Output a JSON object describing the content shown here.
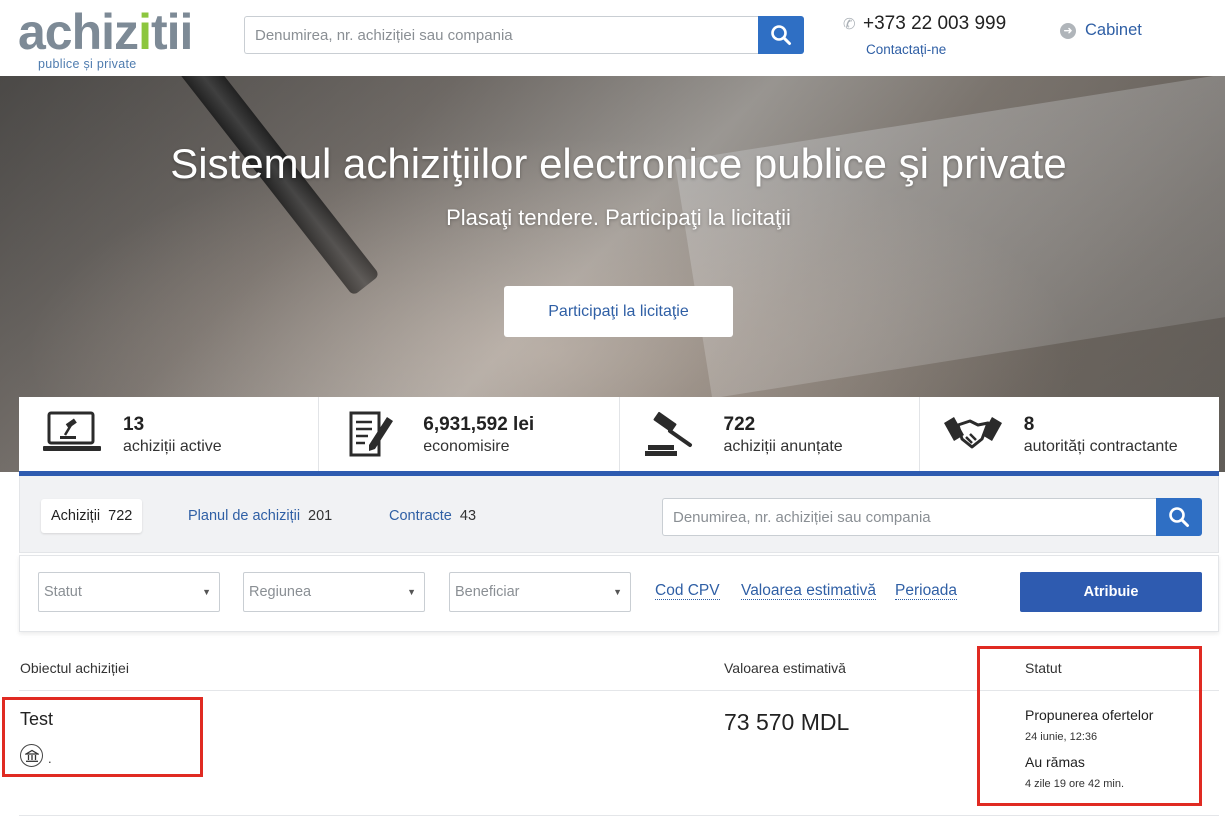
{
  "header": {
    "logo_main_a": "achiz",
    "logo_main_b": "i",
    "logo_main_c": "tii",
    "logo_sub": "publice și private",
    "search_placeholder": "Denumirea, nr. achiziției sau compania",
    "phone": "+373 22 003 999",
    "contact_label": "Contactați-ne",
    "cabinet_label": "Cabinet"
  },
  "hero": {
    "title": "Sistemul achiziţiilor electronice publice şi private",
    "subtitle": "Plasaţi tendere. Participaţi la licitaţii",
    "cta_label": "Participaţi la licitaţie"
  },
  "stats": [
    {
      "number": "13",
      "label": "achiziții active",
      "icon": "laptop-gavel-icon"
    },
    {
      "number": "6,931,592 lei",
      "label": "economisire",
      "icon": "document-pen-icon"
    },
    {
      "number": "722",
      "label": "achiziții anunțate",
      "icon": "gavel-icon"
    },
    {
      "number": "8",
      "label": "autorități contractante",
      "icon": "handshake-icon"
    }
  ],
  "tabs": {
    "achizitii": {
      "label": "Achiziții",
      "count": "722"
    },
    "plan": {
      "label": "Planul de achiziții",
      "count": "201"
    },
    "contracte": {
      "label": "Contracte",
      "count": "43"
    },
    "search_placeholder": "Denumirea, nr. achiziției sau compania"
  },
  "filters": {
    "statut": "Statut",
    "regiunea": "Regiunea",
    "beneficiar": "Beneficiar",
    "cod_cpv": "Cod CPV",
    "valoarea": "Valoarea estimativă",
    "perioada": "Perioada",
    "atribuie": "Atribuie"
  },
  "table": {
    "col_object": "Obiectul achiziției",
    "col_value": "Valoarea estimativă",
    "col_status": "Statut",
    "rows": [
      {
        "title": "Test",
        "buyer_icon": "institution-icon",
        "buyer_text": ".",
        "value": "73 570 MDL",
        "status": "Propunerea ofertelor",
        "status_date": "24 iunie, 12:36",
        "remaining_label": "Au rămas",
        "remaining": "4 zile 19 ore 42 min."
      }
    ]
  },
  "colors": {
    "brand_blue": "#2e5bb0",
    "link_blue": "#2f5fa5",
    "logo_green": "#8cc63f",
    "logo_gray": "#7d8a96",
    "highlight_red": "#e02a22"
  }
}
